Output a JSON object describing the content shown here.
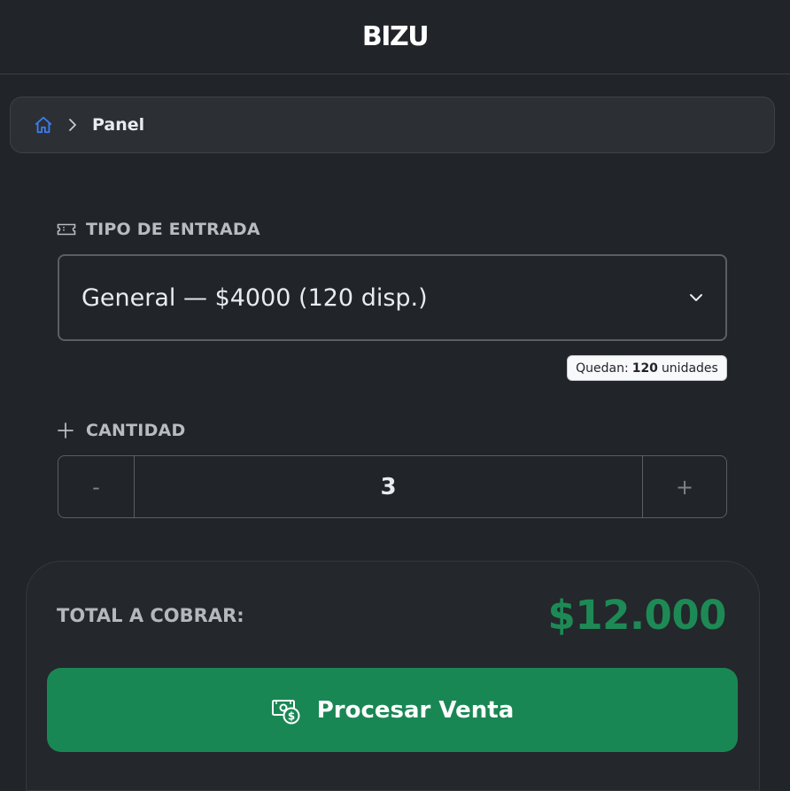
{
  "header": {
    "brand": "BIZU"
  },
  "breadcrumb": {
    "home_icon": "home-icon",
    "current": "Panel"
  },
  "ticket_type": {
    "label": "TIPO DE ENTRADA",
    "icon": "ticket-icon",
    "selected_option": "General — $4000 (120 disp.)"
  },
  "stock": {
    "prefix": "Quedan:",
    "count": "120",
    "suffix": "unidades"
  },
  "quantity": {
    "label": "CANTIDAD",
    "icon": "plus-icon",
    "decrement": "-",
    "value": "3",
    "increment": "+"
  },
  "summary": {
    "label": "TOTAL A COBRAR:",
    "amount": "$12.000"
  },
  "action": {
    "label": "Procesar Venta",
    "icon": "cash-icon"
  },
  "colors": {
    "accent_green": "#198754",
    "amount_green": "#1d8a55",
    "background": "#212429",
    "home_icon_blue": "#3d7cf0"
  }
}
